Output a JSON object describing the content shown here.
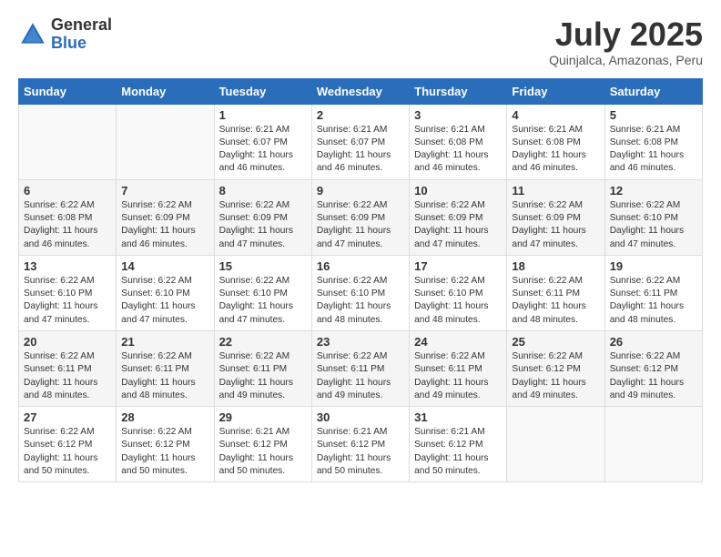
{
  "logo": {
    "general": "General",
    "blue": "Blue"
  },
  "title": "July 2025",
  "subtitle": "Quinjalca, Amazonas, Peru",
  "headers": [
    "Sunday",
    "Monday",
    "Tuesday",
    "Wednesday",
    "Thursday",
    "Friday",
    "Saturday"
  ],
  "weeks": [
    [
      {
        "day": "",
        "info": ""
      },
      {
        "day": "",
        "info": ""
      },
      {
        "day": "1",
        "info": "Sunrise: 6:21 AM\nSunset: 6:07 PM\nDaylight: 11 hours and 46 minutes."
      },
      {
        "day": "2",
        "info": "Sunrise: 6:21 AM\nSunset: 6:07 PM\nDaylight: 11 hours and 46 minutes."
      },
      {
        "day": "3",
        "info": "Sunrise: 6:21 AM\nSunset: 6:08 PM\nDaylight: 11 hours and 46 minutes."
      },
      {
        "day": "4",
        "info": "Sunrise: 6:21 AM\nSunset: 6:08 PM\nDaylight: 11 hours and 46 minutes."
      },
      {
        "day": "5",
        "info": "Sunrise: 6:21 AM\nSunset: 6:08 PM\nDaylight: 11 hours and 46 minutes."
      }
    ],
    [
      {
        "day": "6",
        "info": "Sunrise: 6:22 AM\nSunset: 6:08 PM\nDaylight: 11 hours and 46 minutes."
      },
      {
        "day": "7",
        "info": "Sunrise: 6:22 AM\nSunset: 6:09 PM\nDaylight: 11 hours and 46 minutes."
      },
      {
        "day": "8",
        "info": "Sunrise: 6:22 AM\nSunset: 6:09 PM\nDaylight: 11 hours and 47 minutes."
      },
      {
        "day": "9",
        "info": "Sunrise: 6:22 AM\nSunset: 6:09 PM\nDaylight: 11 hours and 47 minutes."
      },
      {
        "day": "10",
        "info": "Sunrise: 6:22 AM\nSunset: 6:09 PM\nDaylight: 11 hours and 47 minutes."
      },
      {
        "day": "11",
        "info": "Sunrise: 6:22 AM\nSunset: 6:09 PM\nDaylight: 11 hours and 47 minutes."
      },
      {
        "day": "12",
        "info": "Sunrise: 6:22 AM\nSunset: 6:10 PM\nDaylight: 11 hours and 47 minutes."
      }
    ],
    [
      {
        "day": "13",
        "info": "Sunrise: 6:22 AM\nSunset: 6:10 PM\nDaylight: 11 hours and 47 minutes."
      },
      {
        "day": "14",
        "info": "Sunrise: 6:22 AM\nSunset: 6:10 PM\nDaylight: 11 hours and 47 minutes."
      },
      {
        "day": "15",
        "info": "Sunrise: 6:22 AM\nSunset: 6:10 PM\nDaylight: 11 hours and 47 minutes."
      },
      {
        "day": "16",
        "info": "Sunrise: 6:22 AM\nSunset: 6:10 PM\nDaylight: 11 hours and 48 minutes."
      },
      {
        "day": "17",
        "info": "Sunrise: 6:22 AM\nSunset: 6:10 PM\nDaylight: 11 hours and 48 minutes."
      },
      {
        "day": "18",
        "info": "Sunrise: 6:22 AM\nSunset: 6:11 PM\nDaylight: 11 hours and 48 minutes."
      },
      {
        "day": "19",
        "info": "Sunrise: 6:22 AM\nSunset: 6:11 PM\nDaylight: 11 hours and 48 minutes."
      }
    ],
    [
      {
        "day": "20",
        "info": "Sunrise: 6:22 AM\nSunset: 6:11 PM\nDaylight: 11 hours and 48 minutes."
      },
      {
        "day": "21",
        "info": "Sunrise: 6:22 AM\nSunset: 6:11 PM\nDaylight: 11 hours and 48 minutes."
      },
      {
        "day": "22",
        "info": "Sunrise: 6:22 AM\nSunset: 6:11 PM\nDaylight: 11 hours and 49 minutes."
      },
      {
        "day": "23",
        "info": "Sunrise: 6:22 AM\nSunset: 6:11 PM\nDaylight: 11 hours and 49 minutes."
      },
      {
        "day": "24",
        "info": "Sunrise: 6:22 AM\nSunset: 6:11 PM\nDaylight: 11 hours and 49 minutes."
      },
      {
        "day": "25",
        "info": "Sunrise: 6:22 AM\nSunset: 6:12 PM\nDaylight: 11 hours and 49 minutes."
      },
      {
        "day": "26",
        "info": "Sunrise: 6:22 AM\nSunset: 6:12 PM\nDaylight: 11 hours and 49 minutes."
      }
    ],
    [
      {
        "day": "27",
        "info": "Sunrise: 6:22 AM\nSunset: 6:12 PM\nDaylight: 11 hours and 50 minutes."
      },
      {
        "day": "28",
        "info": "Sunrise: 6:22 AM\nSunset: 6:12 PM\nDaylight: 11 hours and 50 minutes."
      },
      {
        "day": "29",
        "info": "Sunrise: 6:21 AM\nSunset: 6:12 PM\nDaylight: 11 hours and 50 minutes."
      },
      {
        "day": "30",
        "info": "Sunrise: 6:21 AM\nSunset: 6:12 PM\nDaylight: 11 hours and 50 minutes."
      },
      {
        "day": "31",
        "info": "Sunrise: 6:21 AM\nSunset: 6:12 PM\nDaylight: 11 hours and 50 minutes."
      },
      {
        "day": "",
        "info": ""
      },
      {
        "day": "",
        "info": ""
      }
    ]
  ]
}
